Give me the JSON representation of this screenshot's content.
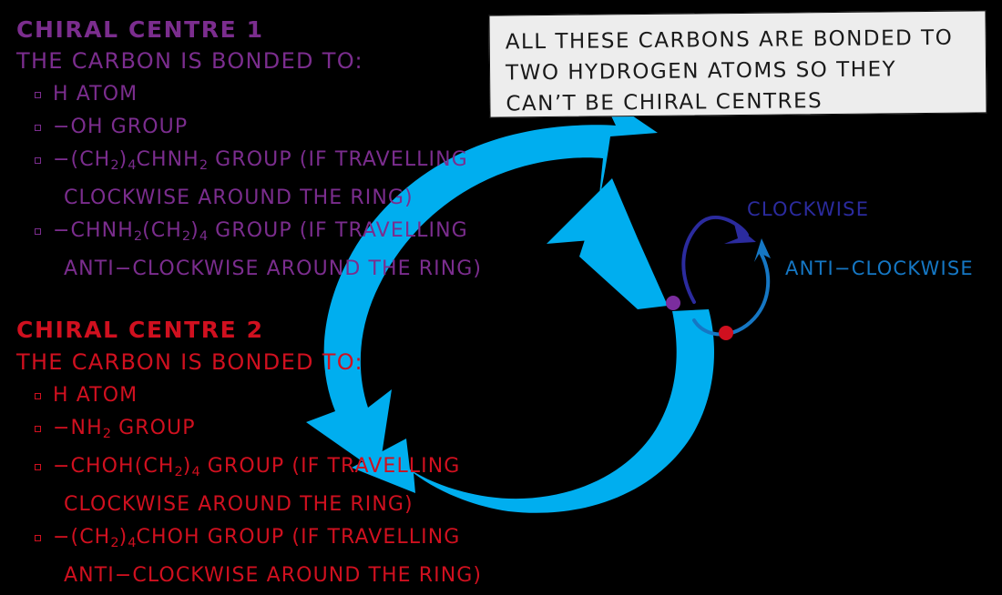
{
  "colors": {
    "background": "#000000",
    "purple": "#7B2D8E",
    "red": "#D0101F",
    "ring_blue": "#00AEEF",
    "clockwise_blue": "#2B2B9E",
    "anticlockwise_blue": "#1577C4",
    "callout_fill": "#EDEDED",
    "callout_border": "#111111",
    "purple_dot": "#7B2D9E",
    "red_dot": "#D0101F"
  },
  "centre1": {
    "heading": "CHIRAL CENTRE 1",
    "subheading": "THE CARBON IS BONDED TO:",
    "items": [
      {
        "parts": [
          {
            "t": "H  ATOM"
          }
        ]
      },
      {
        "parts": [
          {
            "t": "−OH  GROUP"
          }
        ]
      },
      {
        "parts": [
          {
            "t": "−(CH"
          },
          {
            "t": "2",
            "sub": true
          },
          {
            "t": ")"
          },
          {
            "t": "4",
            "sub": true
          },
          {
            "t": "CHNH"
          },
          {
            "t": "2",
            "sub": true
          },
          {
            "t": "  GROUP  (IF  TRAVELLING"
          }
        ],
        "cont": "CLOCKWISE  AROUND  THE  RING)"
      },
      {
        "parts": [
          {
            "t": "−CHNH"
          },
          {
            "t": "2",
            "sub": true
          },
          {
            "t": "(CH"
          },
          {
            "t": "2",
            "sub": true
          },
          {
            "t": ")"
          },
          {
            "t": "4",
            "sub": true
          },
          {
            "t": "  GROUP  (IF  TRAVELLING"
          }
        ],
        "cont": "ANTI−CLOCKWISE  AROUND  THE  RING)"
      }
    ]
  },
  "centre2": {
    "heading": "CHIRAL CENTRE 2",
    "subheading": "THE CARBON IS BONDED TO:",
    "items": [
      {
        "parts": [
          {
            "t": "H  ATOM"
          }
        ]
      },
      {
        "parts": [
          {
            "t": "−NH"
          },
          {
            "t": "2",
            "sub": true
          },
          {
            "t": "  GROUP"
          }
        ]
      },
      {
        "parts": [
          {
            "t": "−CHOH(CH"
          },
          {
            "t": "2",
            "sub": true
          },
          {
            "t": ")"
          },
          {
            "t": "4",
            "sub": true
          },
          {
            "t": "  GROUP  (IF  TRAVELLING"
          }
        ],
        "cont": "CLOCKWISE  AROUND  THE  RING)"
      },
      {
        "parts": [
          {
            "t": "−(CH"
          },
          {
            "t": "2",
            "sub": true
          },
          {
            "t": ")"
          },
          {
            "t": "4",
            "sub": true
          },
          {
            "t": "CHOH  GROUP  (IF  TRAVELLING"
          }
        ],
        "cont": "ANTI−CLOCKWISE  AROUND  THE  RING)"
      }
    ]
  },
  "callout": {
    "lines": [
      "ALL  THESE  CARBONS  ARE  BONDED  TO",
      "TWO  HYDROGEN  ATOMS  SO  THEY",
      "CAN’T  BE  CHIRAL  CENTRES"
    ]
  },
  "legend": {
    "clockwise_label": "CLOCKWISE",
    "anticlockwise_label": "ANTI−CLOCKWISE"
  },
  "diagram": {
    "ring_description": "broken cyclic ring drawn as two thick blue curved arrows meeting at the chiral-centre dot",
    "chiral_centre_1_marker": "purple-dot",
    "chiral_centre_2_marker": "red-dot"
  }
}
